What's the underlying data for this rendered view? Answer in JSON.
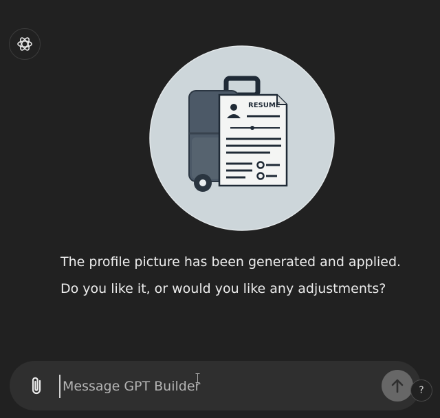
{
  "assistant": {
    "avatar_icon": "openai-logo-icon"
  },
  "profile_image": {
    "icon": "resume-briefcase-image",
    "resume_label": "RESUME"
  },
  "message": {
    "line1": "The profile picture has been generated and applied.",
    "line2": "Do you like it, or would you like any adjustments?"
  },
  "composer": {
    "placeholder": "Message GPT Builder",
    "attach_icon": "paperclip-icon",
    "send_icon": "arrow-up-icon"
  },
  "help": {
    "label": "?"
  },
  "colors": {
    "background": "#212121",
    "composer": "#2f2f2f",
    "send_button": "#676767",
    "text": "#ececec"
  }
}
